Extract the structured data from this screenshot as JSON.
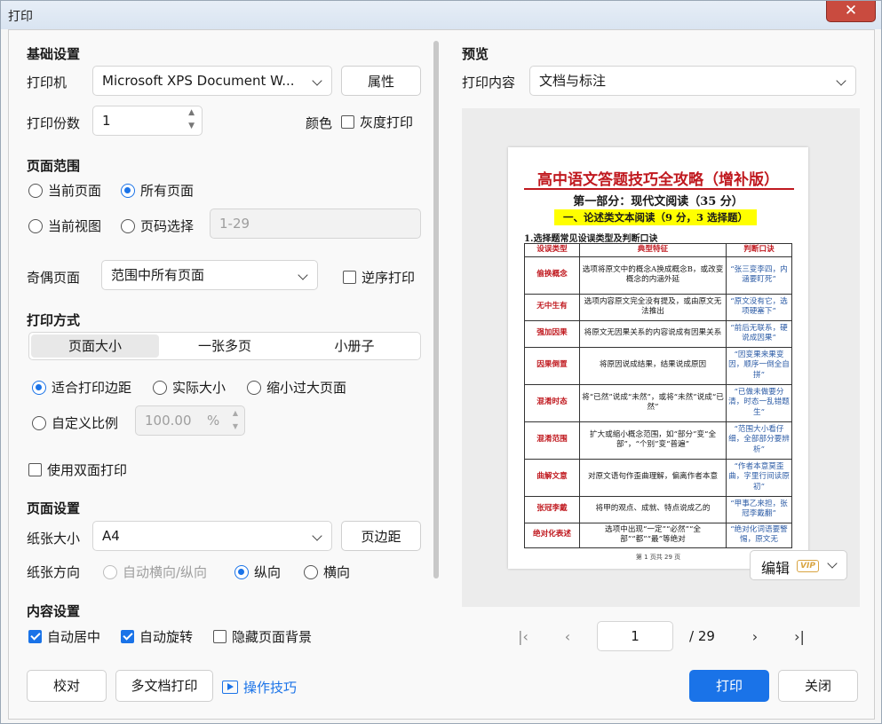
{
  "window": {
    "title": "打印",
    "close_glyph": "✕"
  },
  "basic": {
    "section": "基础设置",
    "printer_label": "打印机",
    "printer_value": "Microsoft XPS Document W...",
    "properties_button": "属性",
    "copies_label": "打印份数",
    "copies_value": "1",
    "color_label": "颜色",
    "grayscale_label": "灰度打印"
  },
  "range": {
    "section": "页面范围",
    "current_page": "当前页面",
    "all_pages": "所有页面",
    "current_view": "当前视图",
    "page_select": "页码选择",
    "page_select_placeholder": "1-29",
    "odd_even_label": "奇偶页面",
    "odd_even_value": "范围中所有页面",
    "reverse_label": "逆序打印"
  },
  "method": {
    "section": "打印方式",
    "tabs": [
      "页面大小",
      "一张多页",
      "小册子"
    ],
    "fit_margins": "适合打印边距",
    "actual_size": "实际大小",
    "shrink_large": "缩小过大页面",
    "custom_scale": "自定义比例",
    "scale_value": "100.00",
    "scale_unit": "%",
    "duplex_label": "使用双面打印"
  },
  "page_setup": {
    "section": "页面设置",
    "paper_size_label": "纸张大小",
    "paper_size_value": "A4",
    "margins_button": "页边距",
    "orientation_label": "纸张方向",
    "auto_orient": "自动横向/纵向",
    "portrait": "纵向",
    "landscape": "横向"
  },
  "content": {
    "section": "内容设置",
    "auto_center": "自动居中",
    "auto_rotate": "自动旋转",
    "hide_background": "隐藏页面背景"
  },
  "footer": {
    "proofread_button": "校对",
    "multi_doc_button": "多文档打印",
    "tips_link": "操作技巧",
    "print_button": "打印",
    "close_button": "关闭"
  },
  "preview": {
    "section": "预览",
    "content_label": "打印内容",
    "content_value": "文档与标注",
    "edit_button": "编辑",
    "vip_badge": "VIP",
    "current_page": "1",
    "total_pages": "/  29",
    "doc": {
      "title": "高中语文答题技巧全攻略（增补版）",
      "subtitle": "第一部分：现代文阅读（35 分）",
      "highlight": "一、论述类文本阅读（9 分，3 选择题）",
      "question": "1.选择题常见设误类型及判断口诀",
      "headers": [
        "设误类型",
        "典型特征",
        "判断口诀"
      ],
      "rows": [
        {
          "type": "偷换概念",
          "feature": "选项将原文中的概念A换成概念B，或改变概念的内涵外延",
          "rule": "“张三变李四，内涵要盯死”"
        },
        {
          "type": "无中生有",
          "feature": "选项内容原文完全没有提及，或由原文无法推出",
          "rule": "“原文没有它，选项硬塞下”"
        },
        {
          "type": "强加因果",
          "feature": "将原文无因果关系的内容说成有因果关系",
          "rule": "“前后无联系，硬说成因果”"
        },
        {
          "type": "因果倒置",
          "feature": "将原因说成结果，结果说成原因",
          "rule": "“因变果来果变因，顺序一倒全自拼”"
        },
        {
          "type": "混淆时态",
          "feature": "将“已然”说成“未然”，或将“未然”说成“已然”",
          "rule": "“已做未做要分清，时态一乱错题生”"
        },
        {
          "type": "混淆范围",
          "feature": "扩大或缩小概念范围，如“部分”变“全部”，“个别”变“普遍”",
          "rule": "“范围大小看仔细，全部部分要辨析”"
        },
        {
          "type": "曲解文意",
          "feature": "对原文语句作歪曲理解，偏离作者本意",
          "rule": "“作者本意莫歪曲，字里行间读原初”"
        },
        {
          "type": "张冠李戴",
          "feature": "将甲的观点、成就、特点说成乙的",
          "rule": "“甲事乙来担，张冠李戴翻”"
        },
        {
          "type": "绝对化表述",
          "feature": "选项中出现“一定”“必然”“全部”“都”“最”等绝对",
          "rule": "“绝对化词语要警惕，原文无"
        }
      ],
      "footer": "第 1 页共 29 页"
    }
  },
  "colors": {
    "accent": "#1a73e8",
    "doc_red": "#c0191f",
    "doc_blue": "#2d5ca6",
    "highlight": "#ffff00"
  }
}
